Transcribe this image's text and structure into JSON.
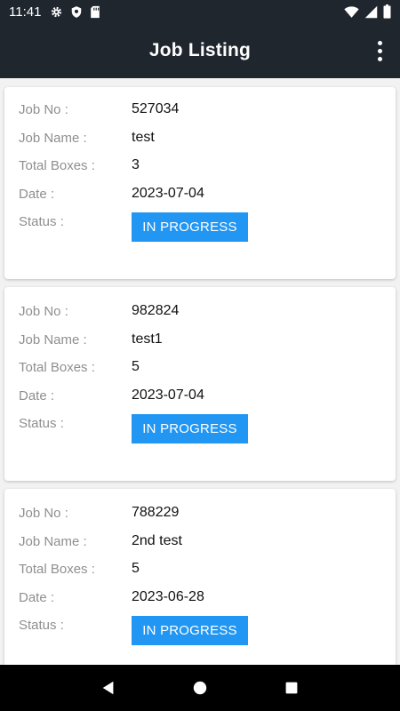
{
  "status_bar": {
    "time": "11:41",
    "icons": [
      "gear-icon",
      "shield-icon",
      "sd-card-icon",
      "wifi-icon",
      "signal-icon",
      "battery-icon"
    ]
  },
  "app_bar": {
    "title": "Job Listing",
    "menu_icon": "more-vert-icon"
  },
  "labels": {
    "job_no": "Job No :",
    "job_name": "Job Name :",
    "total_boxes": "Total Boxes :",
    "date": "Date :",
    "status": "Status :"
  },
  "jobs": [
    {
      "job_no": "527034",
      "job_name": "test",
      "total_boxes": "3",
      "date": "2023-07-04",
      "status": "IN PROGRESS"
    },
    {
      "job_no": "982824",
      "job_name": "test1",
      "total_boxes": "5",
      "date": "2023-07-04",
      "status": "IN PROGRESS"
    },
    {
      "job_no": "788229",
      "job_name": "2nd test",
      "total_boxes": "5",
      "date": "2023-06-28",
      "status": "IN PROGRESS"
    }
  ],
  "nav_bar": {
    "icons": [
      "back-icon",
      "home-icon",
      "recents-icon"
    ]
  },
  "colors": {
    "app_bar": "#1f262e",
    "status_badge": "#2196f3",
    "background": "#f2f2f2",
    "label": "#8f8f8f"
  }
}
